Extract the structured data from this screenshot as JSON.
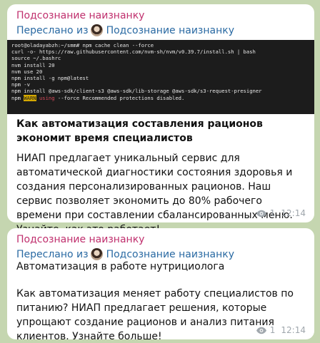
{
  "messages": [
    {
      "sender": "Подсознание наизнанку",
      "forwarded_prefix": "Переслано из",
      "forwarded_from": "Подсознание наизнанку",
      "terminal": {
        "lines": [
          "root@oladayabzh:~/smm# npm cache clean --force",
          "curl -o- https://raw.githubusercontent.com/nvm-sh/nvm/v0.39.7/install.sh | bash",
          "source ~/.bashrc",
          "nvm install 20",
          "nvm use 20",
          "npm install -g npm@latest",
          "npm -v",
          "npm install @aws-sdk/client-s3 @aws-sdk/lib-storage @aws-sdk/s3-request-presigner"
        ],
        "last_line_prefix": "npm ",
        "last_line_tag": "WARN",
        "last_line_word": " using ",
        "last_line_rest": "--force Recommended protections disabled."
      },
      "headline": "Как автоматизация составления рационов экономит время специалистов",
      "body": "НИАП предлагает уникальный сервис для автоматической диагностики состояния здоровья и создания персонализированных рационов. Наш сервис позволяет экономить до 80% рабочего времени при составлении сбалансированных меню. Узнайте, как это работает!",
      "views": "1",
      "time": "12:14"
    },
    {
      "sender": "Подсознание наизнанку",
      "forwarded_prefix": "Переслано из",
      "forwarded_from": "Подсознание наизнанку",
      "title": "Автоматизация в работе нутрициолога",
      "body": "Как автоматизация меняет работу специалистов по питанию? НИАП предлагает решения, которые упрощают создание рационов и анализ питания клиентов. Узнайте больше!",
      "views": "1",
      "time": "12:14"
    }
  ],
  "colors": {
    "sender": "#c0306e",
    "forward": "#2a6aa3",
    "meta": "#a0a7ad",
    "background": "#c5d6b0"
  }
}
